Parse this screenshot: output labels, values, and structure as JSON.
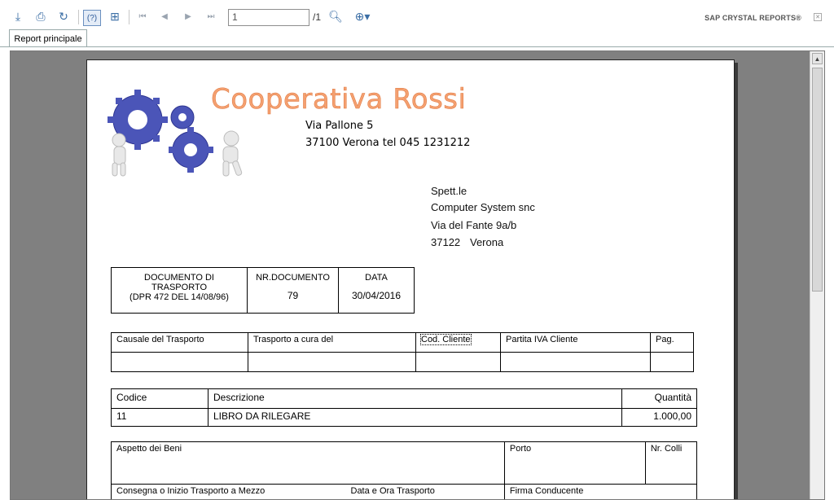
{
  "toolbar": {
    "page_value": "1",
    "page_total": "/1",
    "brand": "SAP CRYSTAL REPORTS®",
    "help_label": "(?)"
  },
  "tabs": [
    {
      "label": "Report principale"
    }
  ],
  "report": {
    "company": "Cooperativa Rossi",
    "company_street": "Via Pallone 5",
    "company_city": "37100 Verona tel 045 1231212",
    "recipient": {
      "salutation": "Spett.le",
      "name": "Computer System snc",
      "street": "Via del Fante 9a/b",
      "zip": "37122",
      "city": "Verona"
    },
    "header_box": {
      "doc_title_1": "DOCUMENTO DI",
      "doc_title_2": "TRASPORTO",
      "doc_title_3": "(DPR 472 DEL 14/08/96)",
      "nr_label": "NR.DOCUMENTO",
      "nr_value": "79",
      "date_label": "DATA",
      "date_value": "30/04/2016"
    },
    "transport_box": {
      "causale": "Causale del Trasporto",
      "a_cura": "Trasporto a cura del",
      "cod_cliente": "Cod. Cliente",
      "partita_iva": "Partita IVA Cliente",
      "pag": "Pag."
    },
    "items_table": {
      "headers": [
        "Codice",
        "Descrizione",
        "Quantità"
      ],
      "rows": [
        [
          "11",
          "LIBRO DA RILEGARE",
          "1.000,00"
        ]
      ]
    },
    "footer_box": {
      "aspetto": "Aspetto dei Beni",
      "porto": "Porto",
      "colli": "Nr. Colli",
      "consegna": "Consegna o Inizio Trasporto a Mezzo",
      "data_ora": "Data e Ora Trasporto",
      "firma": "Firma Conducente"
    }
  }
}
